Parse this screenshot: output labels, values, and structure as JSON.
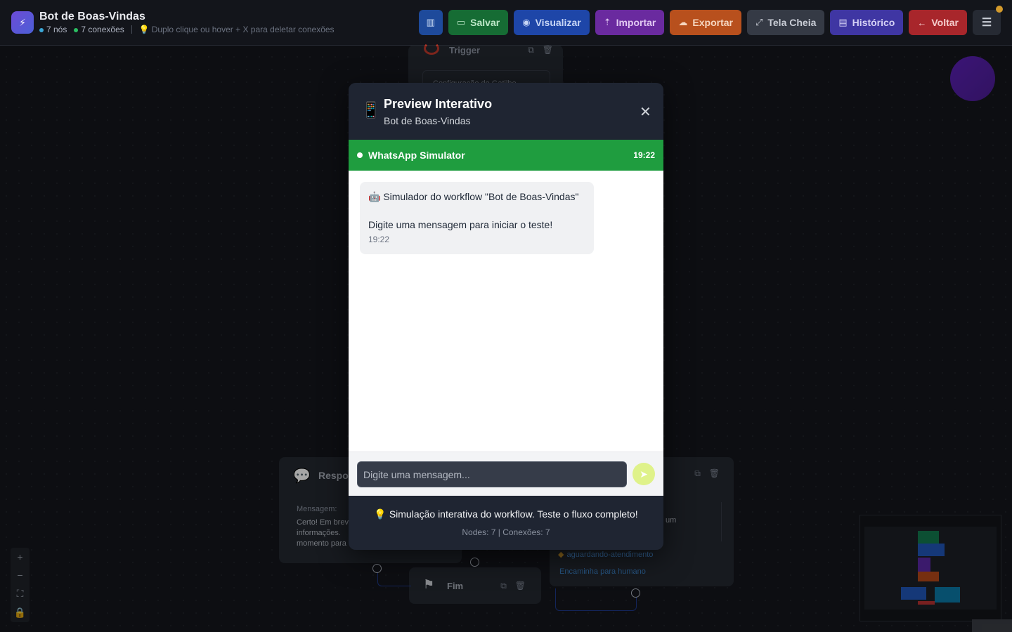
{
  "header": {
    "title": "Bot de Boas-Vindas",
    "nodes_label": "7 nós",
    "connections_label": "7 conexões",
    "hint": "Duplo clique ou hover + X para deletar conexões"
  },
  "toolbar": {
    "save_label": "Salvar",
    "view_label": "Visualizar",
    "import_label": "Importar",
    "export_label": "Exportar",
    "fullscreen_label": "Tela Cheia",
    "history_label": "Histórico",
    "back_label": "Voltar"
  },
  "canvas": {
    "trigger_node": {
      "title": "Trigger",
      "config_label": "Configuração do Gatilho"
    },
    "response_node": {
      "title": "Respos",
      "message_label": "Mensagem:",
      "message_text": "Certo! Em breve informações. momento para"
    },
    "right_node": {
      "text_fragment": "um",
      "tag": "aguardando-atendimento",
      "description": "Encaminha para humano"
    },
    "end_node": {
      "title": "Fim"
    }
  },
  "modal": {
    "title": "Preview Interativo",
    "subtitle": "Bot de Boas-Vindas",
    "simulator": {
      "title": "WhatsApp Simulator",
      "time": "19:22"
    },
    "messages": [
      {
        "line1": "🤖 Simulador do workflow \"Bot de Boas-Vindas\"",
        "line2": "Digite uma mensagem para iniciar o teste!",
        "time": "19:22"
      }
    ],
    "input_placeholder": "Digite uma mensagem...",
    "footer_tip": "Simulação interativa do workflow. Teste o fluxo completo!",
    "footer_stats": "Nodes: 7 | Conexões: 7"
  },
  "colors": {
    "whatsapp_green": "#1f9d3f",
    "save": "#166c34",
    "view": "#1e46a8",
    "import": "#6a2a9f",
    "export": "#b8501d",
    "history": "#3f36a3",
    "back": "#a8262b"
  },
  "icons": {
    "app": "lightning-icon",
    "map": "map-icon",
    "save": "save-icon",
    "view": "eye-icon",
    "import": "upload-icon",
    "export": "cloud-upload-icon",
    "fullscreen": "expand-icon",
    "history": "chart-icon",
    "back": "arrow-left-icon",
    "menu": "hamburger-icon",
    "close": "close-icon",
    "send": "send-icon"
  }
}
